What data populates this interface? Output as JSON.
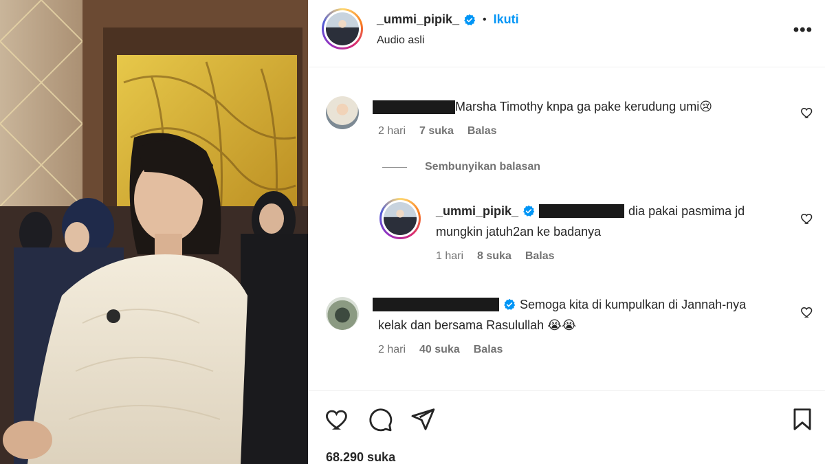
{
  "post": {
    "username": "_ummi_pipik_",
    "dot": "•",
    "follow_label": "Ikuti",
    "audio": "Audio asli",
    "more_icon": "more-options-icon"
  },
  "comments": [
    {
      "text": "Marsha Timothy knpa ga pake kerudung umi😢",
      "time": "2 hari",
      "likes": "7 suka",
      "reply": "Balas"
    },
    {
      "username": "_ummi_pipik_",
      "text_line1": "dia pakai pasmima jd",
      "text_line2": "mungkin jatuh2an ke badanya",
      "time": "1 hari",
      "likes": "8 suka",
      "reply": "Balas"
    },
    {
      "text_line1": "Semoga kita di kumpulkan di Jannah-nya",
      "text_line2": "kelak dan bersama Rasulullah 😭😭",
      "time": "2 hari",
      "likes": "40 suka",
      "reply": "Balas"
    }
  ],
  "hide_replies": "Sembunyikan balasan",
  "likes_total": "68.290 suka",
  "colors": {
    "accent": "#0095f6",
    "verified": "#0095f6",
    "muted": "#737373"
  }
}
